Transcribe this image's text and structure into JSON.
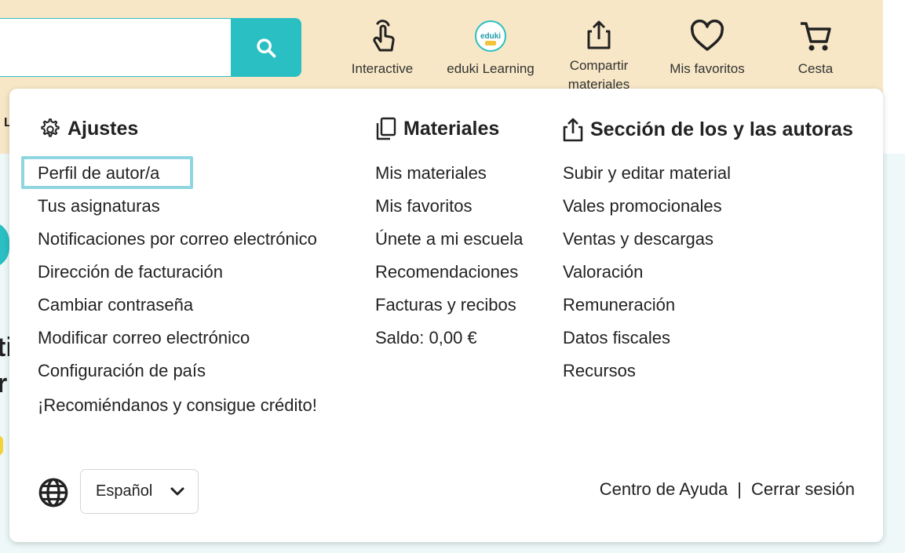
{
  "search": {
    "placeholder": "",
    "value": ""
  },
  "nav": {
    "interactive": "Interactive",
    "eduki_learning": "eduki Learning",
    "eduki_logo_text": "eduki",
    "share_line1": "Compartir",
    "share_line2": "materiales",
    "favorites": "Mis favoritos",
    "cart": "Cesta"
  },
  "background_fragments": {
    "frag_l": "L",
    "frag_ti": "ti",
    "frag_r": "r"
  },
  "menu": {
    "ajustes": {
      "title": "Ajustes",
      "items": [
        "Perfil de autor/a",
        "Tus asignaturas",
        "Notificaciones por correo electrónico",
        "Dirección de facturación",
        "Cambiar contraseña",
        "Modificar correo electrónico",
        "Configuración de país",
        "¡Recomiéndanos y consigue crédito!"
      ]
    },
    "materiales": {
      "title": "Materiales",
      "items": [
        "Mis materiales",
        "Mis favoritos",
        "Únete a mi escuela",
        "Recomendaciones",
        "Facturas y recibos",
        "Saldo: 0,00 €"
      ]
    },
    "autores": {
      "title": "Sección de los y las autoras",
      "items": [
        "Subir y editar material",
        "Vales promocionales",
        "Ventas y descargas",
        "Valoración",
        "Remuneración",
        "Datos fiscales",
        "Recursos"
      ]
    }
  },
  "footer": {
    "language": "Español",
    "help": "Centro de Ayuda",
    "separator": "|",
    "logout": "Cerrar sesión"
  },
  "colors": {
    "header_bg": "#f7e7c6",
    "accent": "#2abfc2",
    "focus_outline": "#8fd6e0",
    "page_bg": "#eef8f8"
  }
}
